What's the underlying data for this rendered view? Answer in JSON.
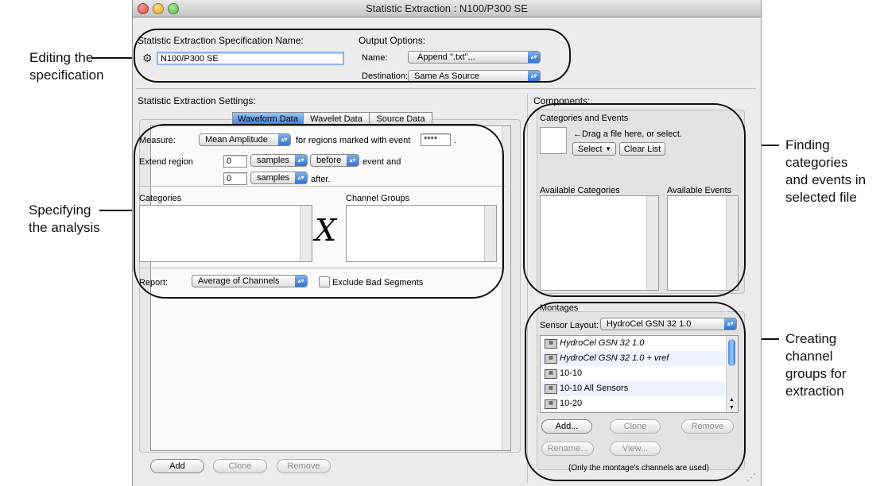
{
  "window": {
    "title": "Statistic Extraction : N100/P300 SE"
  },
  "spec": {
    "heading": "Statistic Extraction Specification Name:",
    "name_value": "N100/P300 SE"
  },
  "output": {
    "heading": "Output Options:",
    "name_label": "Name:",
    "name_value": "Append \".txt\"...",
    "destination_label": "Destination:",
    "destination_value": "Same As Source"
  },
  "settings": {
    "heading": "Statistic Extraction Settings:",
    "tabs": [
      "Waveform Data",
      "Wavelet Data",
      "Source Data"
    ],
    "measure_label": "Measure:",
    "measure_value": "Mean Amplitude",
    "regions_text": "for regions marked with event",
    "event_value": "****",
    "period": ".",
    "extend_label": "Extend region",
    "extend_before_value": "0",
    "unit_before": "samples",
    "direction": "before",
    "event_and": "event and",
    "extend_after_value": "0",
    "unit_after": "samples",
    "after_text": "after.",
    "categories_label": "Categories",
    "channel_groups_label": "Channel Groups",
    "cross_symbol": "X",
    "report_label": "Report:",
    "report_value": "Average of Channels",
    "exclude_label": "Exclude Bad Segments",
    "buttons": {
      "add": "Add",
      "clone": "Clone",
      "remove": "Remove"
    }
  },
  "components": {
    "heading": "Components:",
    "cat_events_heading": "Categories and Events",
    "drag_hint": "←Drag a file here, or select.",
    "select_value": "Select",
    "clear_list": "Clear List",
    "available_categories": "Available Categories",
    "available_events": "Available Events"
  },
  "montages": {
    "heading": "Montages",
    "sensor_layout_label": "Sensor Layout:",
    "sensor_layout_value": "HydroCel GSN 32 1.0",
    "items": [
      {
        "label": "HydroCel GSN 32 1.0",
        "italic": true
      },
      {
        "label": "HydroCel GSN 32 1.0 + vref",
        "italic": true
      },
      {
        "label": "10-10",
        "italic": false
      },
      {
        "label": "10-10 All Sensors",
        "italic": false
      },
      {
        "label": "10-20",
        "italic": false
      }
    ],
    "buttons": {
      "add": "Add...",
      "clone": "Clone",
      "remove": "Remove",
      "rename": "Rename...",
      "view": "View..."
    },
    "footnote": "(Only the montage's channels are used)"
  },
  "callouts": {
    "editing": [
      "Editing the",
      "specification"
    ],
    "specifying": [
      "Specifying",
      "the analysis"
    ],
    "finding": [
      "Finding",
      "categories",
      "and events in",
      "selected file"
    ],
    "creating": [
      "Creating",
      "channel",
      "groups for",
      "extraction"
    ]
  },
  "colors": {
    "window_bg": "#ececec",
    "accent_blue": "#3f83dc",
    "traffic_red": "#e2463f",
    "traffic_yellow": "#e6a81f",
    "traffic_green": "#5cb645"
  }
}
